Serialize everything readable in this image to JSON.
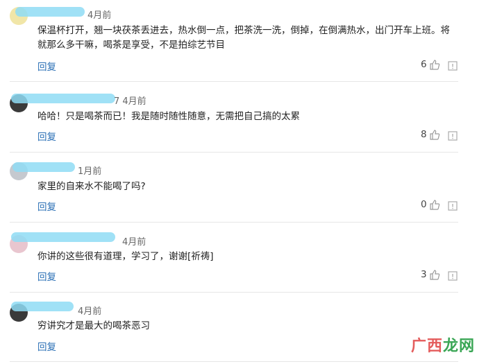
{
  "comments": [
    {
      "time": "4月前",
      "text": "保温杯打开，翘一块茯茶丢进去，热水倒一点，把茶洗一洗，倒掉，在倒满热水，出门开车上班。将就那么多干嘛，喝茶是享受，不是拍综艺节目",
      "reply": "回复",
      "likes": "6"
    },
    {
      "time": "7 4月前",
      "text": "哈哈！只是喝茶而已！我是随时随性随意，无需把自己搞的太累",
      "reply": "回复",
      "likes": "8"
    },
    {
      "time": "1月前",
      "text": "家里的自来水不能喝了吗?",
      "reply": "回复",
      "likes": "0"
    },
    {
      "time": "4月前",
      "text": "你讲的这些很有道理，学习了，谢谢[祈祷]",
      "reply": "回复",
      "likes": "3"
    },
    {
      "time": "4月前",
      "text": "穷讲究才是最大的喝茶恶习",
      "reply": "回复",
      "likes": ""
    }
  ],
  "watermark": {
    "part1": "广西",
    "part2": "龙网"
  },
  "colors": {
    "reply": "#2a6fb5",
    "blur": "#8fdcf5",
    "divider": "#e6e6e6"
  }
}
